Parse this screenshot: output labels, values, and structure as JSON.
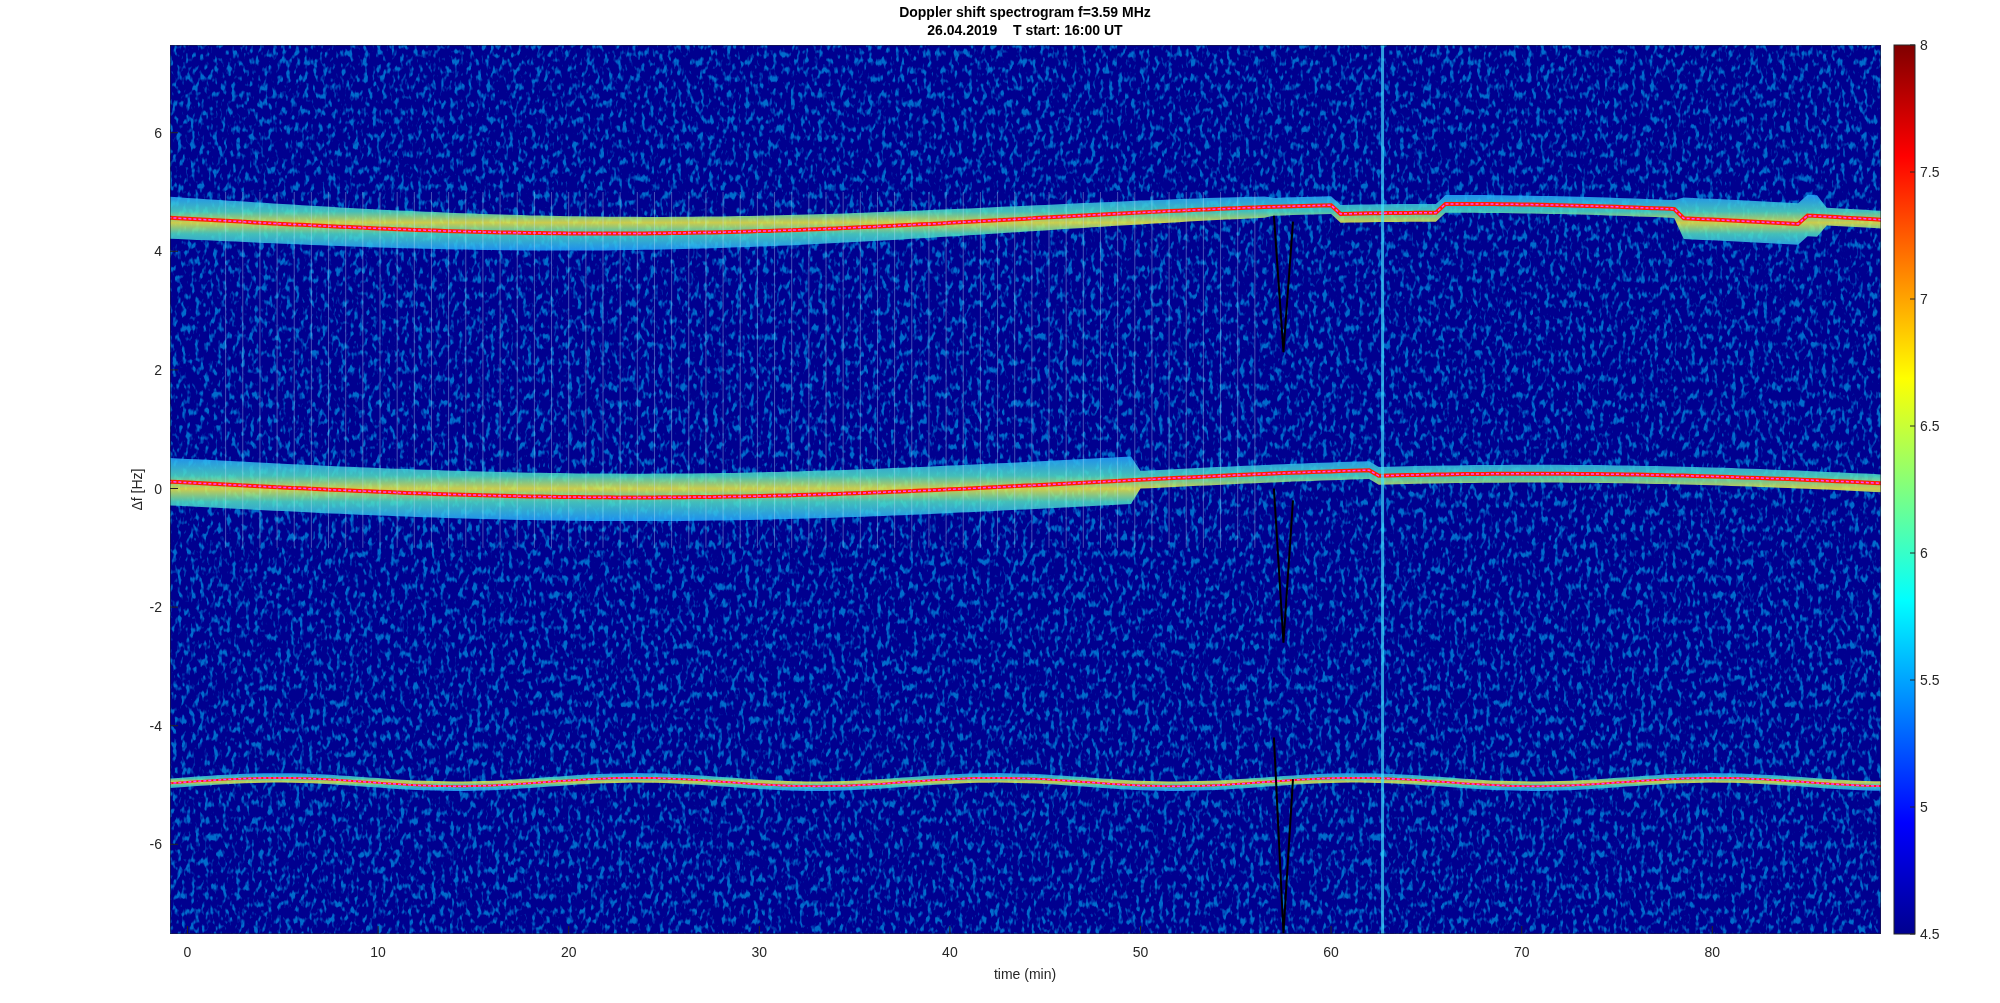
{
  "title": [
    "Doppler shift spectrogram f=3.59 MHz",
    "26.04.2019    T start: 16:00 UT"
  ],
  "plot": {
    "xlabel": "time (min)",
    "ylabel": "Δf [Hz]",
    "xticks": [
      "0",
      "10",
      "20",
      "30",
      "40",
      "50",
      "60",
      "70",
      "80"
    ],
    "yticks": [
      "6",
      "4",
      "2",
      "0",
      "-2",
      "-4",
      "-6"
    ]
  },
  "colorbar": {
    "ticks": [
      "8",
      "7.5",
      "7",
      "6.5",
      "6",
      "5.5",
      "5",
      "4.5"
    ]
  }
}
